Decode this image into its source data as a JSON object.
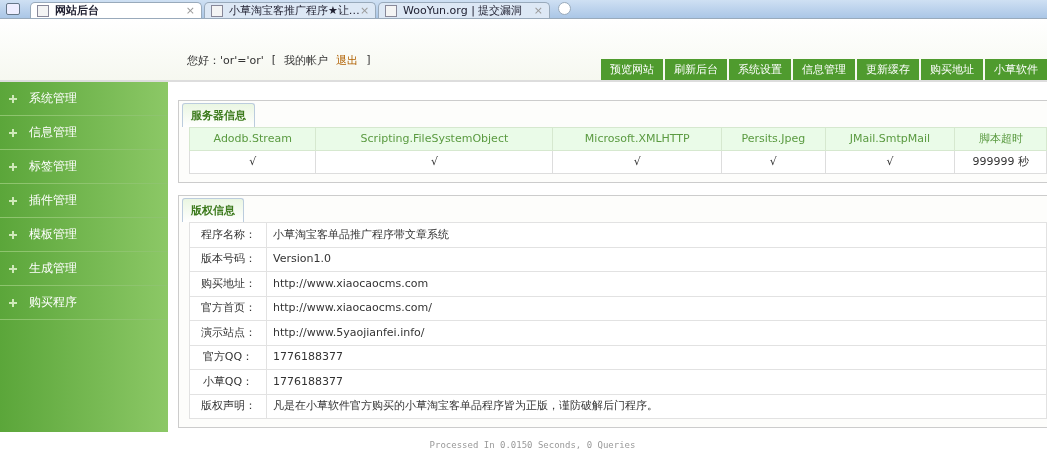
{
  "browser_tabs": [
    {
      "title": "网站后台",
      "selected": true,
      "close": "×"
    },
    {
      "title": "小草淘宝客推广程序★让…",
      "selected": false,
      "close": "×"
    },
    {
      "title": "WooYun.org | 提交漏洞",
      "selected": false,
      "close": "×"
    }
  ],
  "header": {
    "greeting": "您好：'or'='or'",
    "bracket_open": "[",
    "account_link": "我的帐户",
    "logout_link": "退出",
    "bracket_close": "]"
  },
  "top_nav": [
    "预览网站",
    "刷新后台",
    "系统设置",
    "信息管理",
    "更新缓存",
    "购买地址",
    "小草软件"
  ],
  "sidebar": {
    "items": [
      "系统管理",
      "信息管理",
      "标签管理",
      "插件管理",
      "模板管理",
      "生成管理",
      "购买程序"
    ]
  },
  "server_panel": {
    "tab": "服务器信息",
    "columns": [
      "Adodb.Stream",
      "Scripting.FileSystemObject",
      "Microsoft.XMLHTTP",
      "Persits.Jpeg",
      "JMail.SmtpMail",
      "脚本超时"
    ],
    "values": [
      "√",
      "√",
      "√",
      "√",
      "√",
      "999999 秒"
    ]
  },
  "copyright_panel": {
    "tab": "版权信息",
    "rows": [
      {
        "label": "程序名称：",
        "value": "小草淘宝客单品推广程序带文章系统"
      },
      {
        "label": "版本号码：",
        "value": "Version1.0"
      },
      {
        "label": "购买地址：",
        "value": "http://www.xiaocaocms.com"
      },
      {
        "label": "官方首页：",
        "value": "http://www.xiaocaocms.com/"
      },
      {
        "label": "演示站点：",
        "value": "http://www.5yaojianfei.info/"
      },
      {
        "label": "官方QQ：",
        "value": "1776188377"
      },
      {
        "label": "小草QQ：",
        "value": "1776188377"
      },
      {
        "label": "版权声明：",
        "value": "凡是在小草软件官方购买的小草淘宝客单品程序皆为正版，谨防破解后门程序。"
      }
    ]
  },
  "footer": "Processed In 0.0150 Seconds, 0 Queries"
}
